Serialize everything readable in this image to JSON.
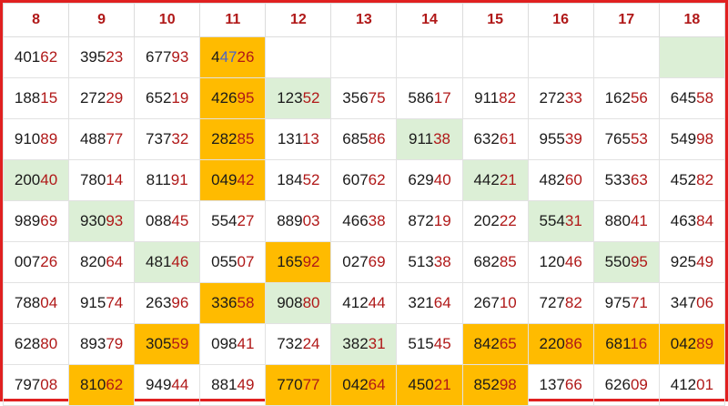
{
  "columns": [
    "8",
    "9",
    "10",
    "11",
    "12",
    "13",
    "14",
    "15",
    "16",
    "17",
    "18"
  ],
  "rows": [
    [
      {
        "p": "401",
        "s": "62"
      },
      {
        "p": "395",
        "s": "23"
      },
      {
        "p": "677",
        "s": "93"
      },
      {
        "p": "4",
        "m": "47",
        "s": "26",
        "hl": "orange"
      },
      {
        "p": "",
        "s": ""
      },
      {
        "p": "",
        "s": ""
      },
      {
        "p": "",
        "s": ""
      },
      {
        "p": "",
        "s": ""
      },
      {
        "p": "",
        "s": ""
      },
      {
        "p": "",
        "s": ""
      },
      {
        "p": "",
        "s": "",
        "hl": "green"
      }
    ],
    [
      {
        "p": "188",
        "s": "15"
      },
      {
        "p": "272",
        "s": "29"
      },
      {
        "p": "652",
        "s": "19"
      },
      {
        "p": "426",
        "s": "95",
        "hl": "orange"
      },
      {
        "p": "123",
        "s": "52",
        "hl": "green"
      },
      {
        "p": "356",
        "s": "75"
      },
      {
        "p": "586",
        "s": "17"
      },
      {
        "p": "911",
        "s": "82"
      },
      {
        "p": "272",
        "s": "33"
      },
      {
        "p": "162",
        "s": "56"
      },
      {
        "p": "645",
        "s": "58"
      }
    ],
    [
      {
        "p": "910",
        "s": "89"
      },
      {
        "p": "488",
        "s": "77"
      },
      {
        "p": "737",
        "s": "32"
      },
      {
        "p": "282",
        "s": "85",
        "hl": "orange"
      },
      {
        "p": "131",
        "s": "13"
      },
      {
        "p": "685",
        "s": "86"
      },
      {
        "p": "911",
        "s": "38",
        "hl": "green"
      },
      {
        "p": "632",
        "s": "61"
      },
      {
        "p": "955",
        "s": "39"
      },
      {
        "p": "765",
        "s": "53"
      },
      {
        "p": "549",
        "s": "98"
      }
    ],
    [
      {
        "p": "200",
        "s": "40",
        "hl": "green"
      },
      {
        "p": "780",
        "s": "14"
      },
      {
        "p": "811",
        "s": "91"
      },
      {
        "p": "049",
        "s": "42",
        "hl": "orange"
      },
      {
        "p": "184",
        "s": "52"
      },
      {
        "p": "607",
        "s": "62"
      },
      {
        "p": "629",
        "s": "40"
      },
      {
        "p": "442",
        "s": "21",
        "hl": "green"
      },
      {
        "p": "482",
        "s": "60"
      },
      {
        "p": "533",
        "s": "63"
      },
      {
        "p": "452",
        "s": "82"
      }
    ],
    [
      {
        "p": "989",
        "s": "69"
      },
      {
        "p": "930",
        "s": "93",
        "hl": "green"
      },
      {
        "p": "088",
        "s": "45"
      },
      {
        "p": "554",
        "s": "27"
      },
      {
        "p": "889",
        "s": "03"
      },
      {
        "p": "466",
        "s": "38"
      },
      {
        "p": "872",
        "s": "19"
      },
      {
        "p": "202",
        "s": "22"
      },
      {
        "p": "554",
        "s": "31",
        "hl": "green"
      },
      {
        "p": "880",
        "s": "41"
      },
      {
        "p": "463",
        "s": "84"
      }
    ],
    [
      {
        "p": "007",
        "s": "26"
      },
      {
        "p": "820",
        "s": "64"
      },
      {
        "p": "481",
        "s": "46",
        "hl": "green"
      },
      {
        "p": "055",
        "s": "07"
      },
      {
        "p": "165",
        "s": "92",
        "hl": "orange"
      },
      {
        "p": "027",
        "s": "69"
      },
      {
        "p": "513",
        "s": "38"
      },
      {
        "p": "682",
        "s": "85"
      },
      {
        "p": "120",
        "s": "46"
      },
      {
        "p": "550",
        "s": "95",
        "hl": "green"
      },
      {
        "p": "925",
        "s": "49"
      }
    ],
    [
      {
        "p": "788",
        "s": "04"
      },
      {
        "p": "915",
        "s": "74"
      },
      {
        "p": "263",
        "s": "96"
      },
      {
        "p": "336",
        "s": "58",
        "hl": "orange"
      },
      {
        "p": "908",
        "s": "80",
        "hl": "green"
      },
      {
        "p": "412",
        "s": "44"
      },
      {
        "p": "321",
        "s": "64"
      },
      {
        "p": "267",
        "s": "10"
      },
      {
        "p": "727",
        "s": "82"
      },
      {
        "p": "975",
        "s": "71"
      },
      {
        "p": "347",
        "s": "06"
      }
    ],
    [
      {
        "p": "628",
        "s": "80"
      },
      {
        "p": "893",
        "s": "79"
      },
      {
        "p": "305",
        "s": "59",
        "hl": "orange"
      },
      {
        "p": "098",
        "s": "41"
      },
      {
        "p": "732",
        "s": "24"
      },
      {
        "p": "382",
        "s": "31",
        "hl": "green"
      },
      {
        "p": "515",
        "s": "45"
      },
      {
        "p": "842",
        "s": "65",
        "hl": "orange"
      },
      {
        "p": "220",
        "s": "86",
        "hl": "orange"
      },
      {
        "p": "681",
        "s": "16",
        "hl": "orange"
      },
      {
        "p": "042",
        "s": "89",
        "hl": "orange"
      }
    ],
    [
      {
        "p": "797",
        "s": "08"
      },
      {
        "p": "810",
        "s": "62",
        "hl": "orange"
      },
      {
        "p": "949",
        "s": "44"
      },
      {
        "p": "881",
        "s": "49"
      },
      {
        "p": "770",
        "s": "77",
        "hl": "orange"
      },
      {
        "p": "042",
        "s": "64",
        "hl": "orange"
      },
      {
        "p": "450",
        "s": "21",
        "hl": "orange"
      },
      {
        "p": "852",
        "s": "98",
        "hl": "orange"
      },
      {
        "p": "137",
        "s": "66"
      },
      {
        "p": "626",
        "s": "09"
      },
      {
        "p": "412",
        "s": "01"
      }
    ]
  ],
  "colors": {
    "border": "#e02020",
    "header_text": "#b01818",
    "suffix_text": "#b01818",
    "orange_highlight": "#ffbb00",
    "green_highlight": "#dcefd6"
  }
}
